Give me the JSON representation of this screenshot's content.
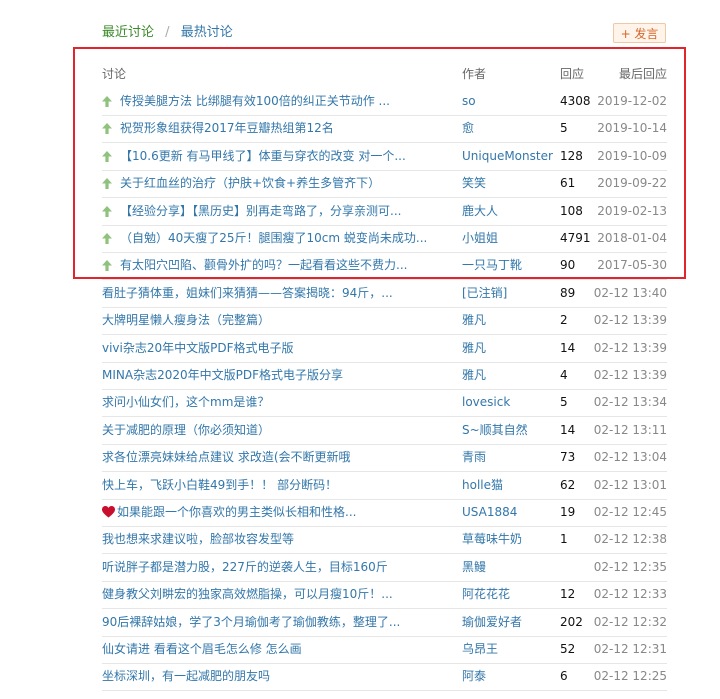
{
  "tabs": [
    {
      "label": "最近讨论",
      "active": true
    },
    {
      "label": "最热讨论",
      "active": false
    }
  ],
  "tab_separator": "/",
  "post_button": {
    "label": "+ 发言"
  },
  "table": {
    "headers": {
      "title": "讨论",
      "author": "作者",
      "replies": "回应",
      "last": "最后回应"
    },
    "pinned": [
      {
        "title": "传授美腿方法 比绑腿有效100倍的纠正关节动作 ...",
        "author": "so",
        "replies": "4308",
        "last": "2019-12-02"
      },
      {
        "title": "祝贺形象组获得2017年豆瓣热组第12名",
        "author": "愈",
        "replies": "5",
        "last": "2019-10-14"
      },
      {
        "title": "【10.6更新 有马甲线了】体重与穿衣的改变 对一个...",
        "author": "UniqueMonster",
        "replies": "128",
        "last": "2019-10-09"
      },
      {
        "title": "关于红血丝的治疗（护肤+饮食+养生多管齐下）",
        "author": "笑笑",
        "replies": "61",
        "last": "2019-09-22"
      },
      {
        "title": "【经验分享】【黑历史】别再走弯路了，分享亲测可...",
        "author": "鹿大人",
        "replies": "108",
        "last": "2019-02-13"
      },
      {
        "title": "（自勉）40天瘦了25斤！腿围瘦了10cm 蜕变尚未成功...",
        "author": "小姐姐",
        "replies": "4791",
        "last": "2018-01-04"
      },
      {
        "title": "有太阳穴凹陷、颧骨外扩的吗？一起看看这些不费力...",
        "author": "一只马丁靴",
        "replies": "90",
        "last": "2017-05-30"
      }
    ],
    "rows": [
      {
        "title": "看肚子猜体重，姐妹们来猜猜——答案揭晓：94斤，...",
        "author": "[已注销]",
        "replies": "89",
        "last": "02-12 13:40"
      },
      {
        "title": "大牌明星懒人瘦身法（完整篇）",
        "author": "雅凡",
        "replies": "2",
        "last": "02-12 13:39"
      },
      {
        "title": "vivi杂志20年中文版PDF格式电子版",
        "author": "雅凡",
        "replies": "14",
        "last": "02-12 13:39"
      },
      {
        "title": "MINA杂志2020年中文版PDF格式电子版分享",
        "author": "雅凡",
        "replies": "4",
        "last": "02-12 13:39"
      },
      {
        "title": "求问小仙女们，这个mm是谁？",
        "author": "lovesick",
        "replies": "5",
        "last": "02-12 13:34"
      },
      {
        "title": "关于减肥的原理（你必须知道）",
        "author": "S~顺其自然",
        "replies": "14",
        "last": "02-12 13:11"
      },
      {
        "title": "求各位漂亮妹妹给点建议 求改造(会不断更新哦",
        "author": "青雨",
        "replies": "73",
        "last": "02-12 13:04"
      },
      {
        "title": "快上车，飞跃小白鞋49到手！！ 部分断码！",
        "author": "holle猫",
        "replies": "62",
        "last": "02-12 13:01"
      },
      {
        "title": "如果能跟一个你喜欢的男主类似长相和性格...",
        "author": "USA1884",
        "replies": "19",
        "last": "02-12 12:45",
        "heart": true
      },
      {
        "title": "我也想来求建议啦，脸部妆容发型等",
        "author": "草莓味牛奶",
        "replies": "1",
        "last": "02-12 12:38"
      },
      {
        "title": "听说胖子都是潜力股，227斤的逆袭人生，目标160斤",
        "author": "黑鳗",
        "replies": "",
        "last": "02-12 12:35"
      },
      {
        "title": "健身教父刘畊宏的独家高效燃脂操，可以月瘦10斤！...",
        "author": "阿花花花",
        "replies": "12",
        "last": "02-12 12:33"
      },
      {
        "title": "90后裸辞姑娘，学了3个月瑜伽考了瑜伽教练，整理了...",
        "author": "瑜伽爱好者",
        "replies": "202",
        "last": "02-12 12:32"
      },
      {
        "title": "仙女请进 看看这个眉毛怎么修 怎么画",
        "author": "乌昂王",
        "replies": "52",
        "last": "02-12 12:31"
      },
      {
        "title": "坐标深圳，有一起减肥的朋友吗",
        "author": "阿泰",
        "replies": "6",
        "last": "02-12 12:25"
      }
    ]
  },
  "colors": {
    "link": "#3377aa",
    "active_tab": "#3d8a29",
    "highlight_border": "#e0262c",
    "up_arrow": "#8fc27d",
    "heart": "#c8102e"
  },
  "icons": {
    "pinned": "up-arrow-icon",
    "heart": "heart-icon"
  }
}
